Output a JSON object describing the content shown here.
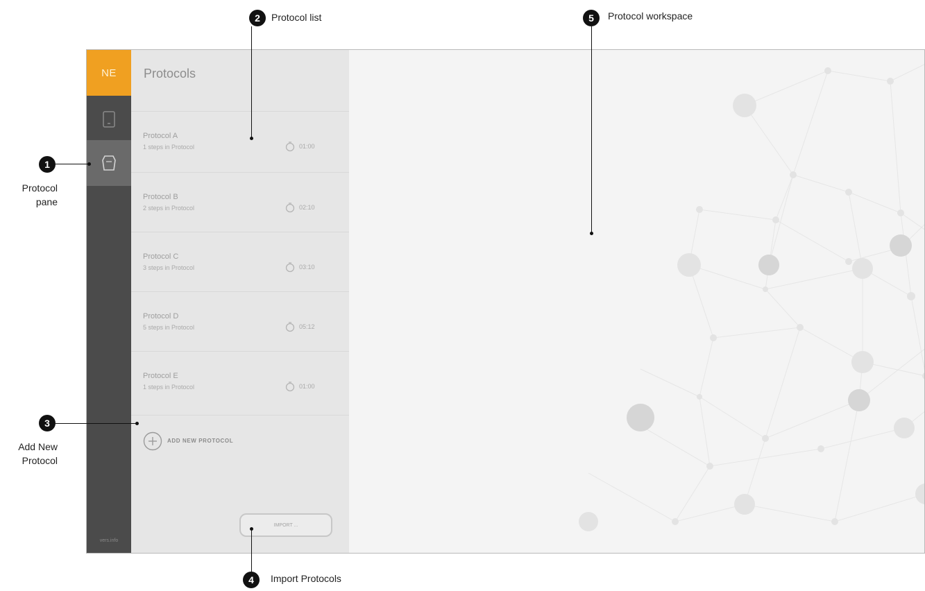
{
  "app": {
    "logo": "NE",
    "footer": "vers.info",
    "list_title": "Protocols",
    "protocols": [
      {
        "name": "Protocol A",
        "steps": "1 steps in Protocol",
        "time": "01:00"
      },
      {
        "name": "Protocol B",
        "steps": "2 steps in Protocol",
        "time": "02:10"
      },
      {
        "name": "Protocol C",
        "steps": "3 steps in Protocol",
        "time": "03:10"
      },
      {
        "name": "Protocol D",
        "steps": "5 steps in Protocol",
        "time": "05:12"
      },
      {
        "name": "Protocol E",
        "steps": "1 steps in Protocol",
        "time": "01:00"
      }
    ],
    "add_label": "ADD NEW PROTOCOL",
    "import_label": "IMPORT ...",
    "colors": {
      "accent": "#f0a021",
      "rail": "#4b4b4b",
      "list": "#e6e6e6"
    }
  },
  "callouts": [
    {
      "n": "1",
      "label": "Protocol\npane"
    },
    {
      "n": "2",
      "label": "Protocol list"
    },
    {
      "n": "3",
      "label": "Add New\nProtocol"
    },
    {
      "n": "4",
      "label": "Import Protocols"
    },
    {
      "n": "5",
      "label": "Protocol workspace"
    }
  ],
  "icons": {
    "devices": "device-icon",
    "protocols": "protocol-icon",
    "timer": "timer-icon",
    "add": "plus-circle-icon"
  }
}
